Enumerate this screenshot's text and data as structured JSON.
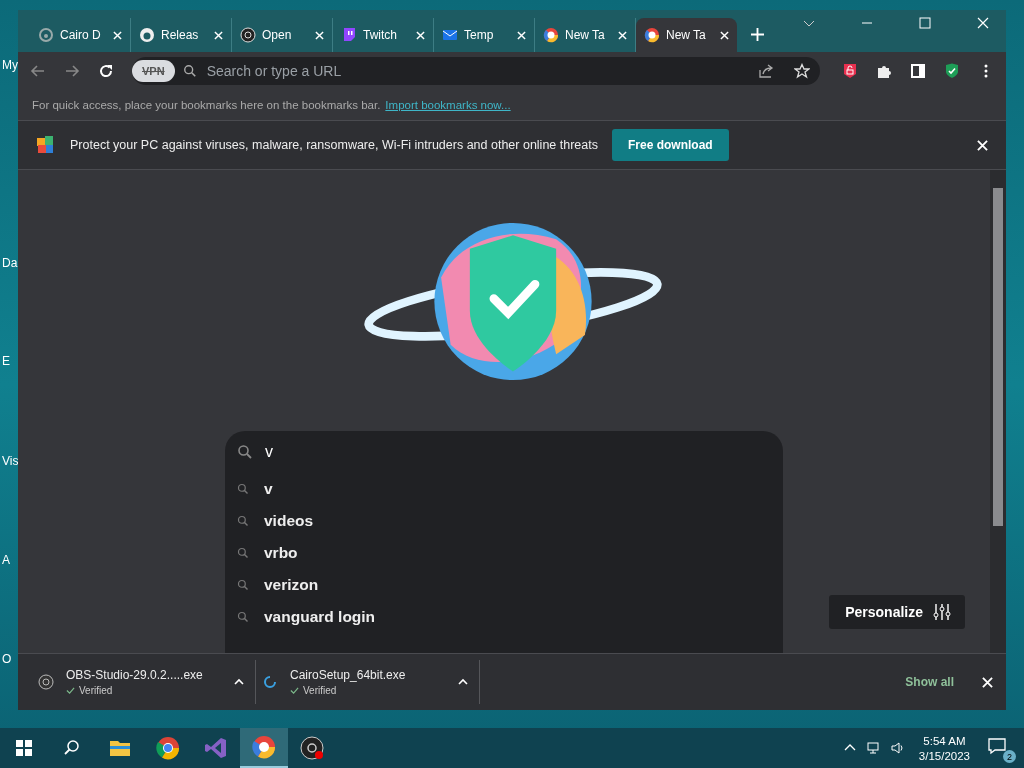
{
  "desktop_icons": [
    "My",
    "Da",
    "E",
    "Vis",
    "A",
    "O"
  ],
  "tabs": [
    {
      "title": "Cairo D",
      "kind": "cairo",
      "selected": false
    },
    {
      "title": "Releas",
      "kind": "github",
      "selected": false
    },
    {
      "title": "Open",
      "kind": "obs",
      "selected": false
    },
    {
      "title": "Twitch",
      "kind": "twitch",
      "selected": false
    },
    {
      "title": "Temp",
      "kind": "mail",
      "selected": false
    },
    {
      "title": "New Ta",
      "kind": "browser",
      "selected": false
    },
    {
      "title": "New Ta",
      "kind": "browser",
      "selected": true
    }
  ],
  "address_bar": {
    "vpn_badge": "VPN",
    "placeholder": "Search or type a URL"
  },
  "bookmarks_bar": {
    "text": "For quick access, place your bookmarks here on the bookmarks bar.",
    "link": "Import bookmarks now..."
  },
  "banner": {
    "message": "Protect your PC against viruses, malware, ransomware, Wi-Fi intruders and other online threats",
    "button": "Free download"
  },
  "search": {
    "value": "v",
    "suggestions": [
      "v",
      "videos",
      "vrbo",
      "verizon",
      "vanguard login"
    ]
  },
  "personalize": "Personalize",
  "downloads": [
    {
      "name": "OBS-Studio-29.0.2.....exe",
      "status": "Verified",
      "kind": "obs"
    },
    {
      "name": "CairoSetup_64bit.exe",
      "status": "Verified",
      "kind": "cairo"
    }
  ],
  "show_all": "Show all",
  "taskbar": {
    "apps": [
      {
        "kind": "explorer",
        "selected": false
      },
      {
        "kind": "chrome",
        "selected": false
      },
      {
        "kind": "vs",
        "selected": false
      },
      {
        "kind": "browser",
        "selected": true
      },
      {
        "kind": "obs",
        "selected": false
      }
    ],
    "time": "5:54 AM",
    "date": "3/15/2023",
    "notifications": "2"
  }
}
